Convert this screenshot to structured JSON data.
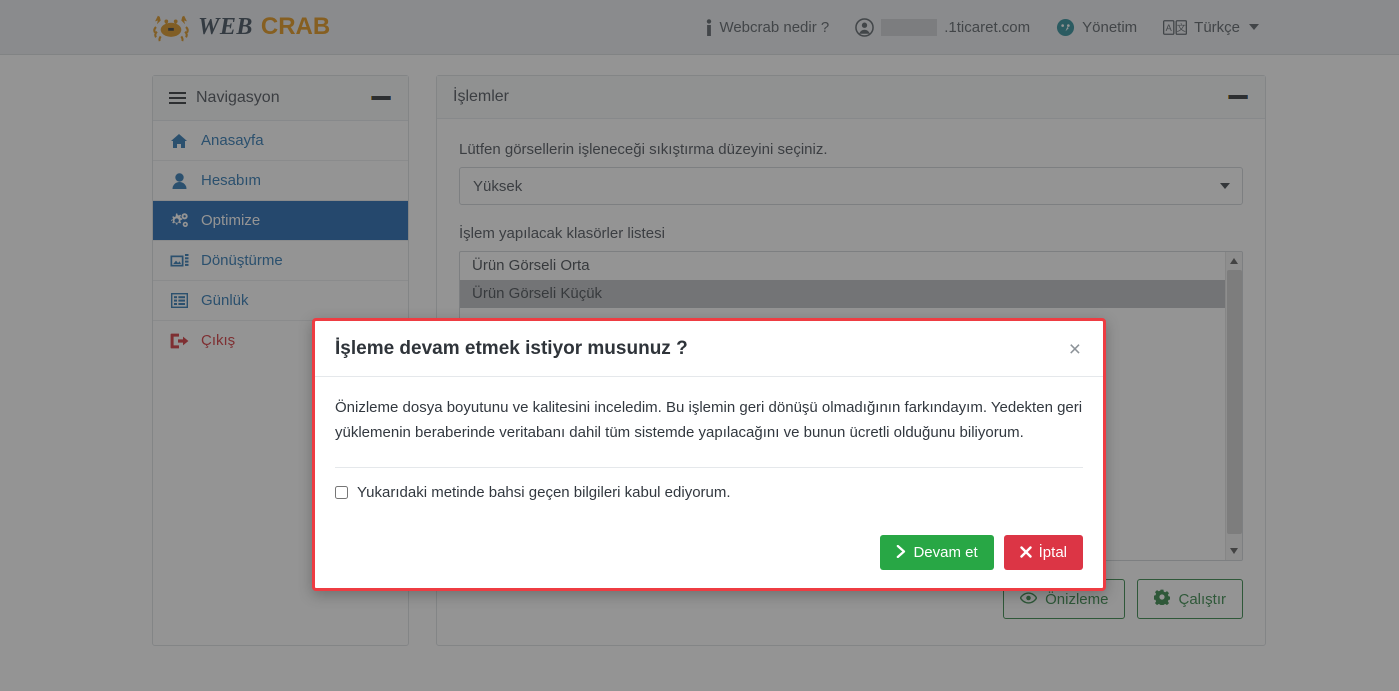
{
  "navbar": {
    "brand": {
      "word_left": "WEB",
      "word_right": "CRAB",
      "icon": "crab-icon"
    },
    "links": [
      {
        "label": "Webcrab nedir ?",
        "icon": "info-icon"
      },
      {
        "label": ".1ticaret.com",
        "icon": "user-circle-icon",
        "redacted": true
      },
      {
        "label": "Yönetim",
        "icon": "dashboard-icon"
      },
      {
        "label": "Türkçe",
        "icon": "language-icon",
        "caret": true
      }
    ]
  },
  "sidebar": {
    "title": "Navigasyon",
    "title_icon": "hamburger-icon",
    "collapse_icon": "minus-icon",
    "items": [
      {
        "label": "Anasayfa",
        "icon": "home-icon",
        "active": false
      },
      {
        "label": "Hesabım",
        "icon": "user-icon",
        "active": false
      },
      {
        "label": "Optimize",
        "icon": "gears-icon",
        "active": true
      },
      {
        "label": "Dönüştürme",
        "icon": "images-icon",
        "active": false
      },
      {
        "label": "Günlük",
        "icon": "list-icon",
        "active": false
      },
      {
        "label": "Çıkış",
        "icon": "logout-icon",
        "active": false
      }
    ]
  },
  "main": {
    "title": "İşlemler",
    "collapse_icon": "minus-icon",
    "compression": {
      "label": "Lütfen görsellerin işleneceği sıkıştırma düzeyini seçiniz.",
      "selected": "Yüksek",
      "options": [
        "Yüksek"
      ]
    },
    "folders": {
      "label": "İşlem yapılacak klasörler listesi",
      "options": [
        {
          "label": "Ürün Görseli Orta",
          "selected": false
        },
        {
          "label": "Ürün Görseli Küçük",
          "selected": true
        }
      ]
    },
    "buttons": [
      {
        "label": "Önizleme",
        "icon": "eye-icon"
      },
      {
        "label": "Çalıştır",
        "icon": "gear-icon"
      }
    ]
  },
  "modal": {
    "title": "İşleme devam etmek istiyor musunuz ?",
    "close_label": "×",
    "paragraph": "Önizleme dosya boyutunu ve kalitesini inceledim. Bu işlemin geri dönüşü olmadığının farkındayım. Yedekten geri yüklemenin beraberinde veritabanı dahil tüm sistemde yapılacağını ve bunun ücretli olduğunu biliyorum.",
    "agree_label": "Yukarıdaki metinde bahsi geçen bilgileri kabul ediyorum.",
    "agree_checked": false,
    "confirm_label": "Devam et",
    "confirm_icon": "chevron-right-icon",
    "cancel_label": "İptal",
    "cancel_icon": "x-icon"
  },
  "colors": {
    "brand_orange": "#e08a00",
    "sidebar_active": "#0a58a8",
    "link_blue": "#1769aa",
    "danger_red": "#cf2027",
    "modal_border": "#ee3c42",
    "confirm_green": "#28a745",
    "cancel_red": "#dc3545",
    "outline_green": "#1f7a35",
    "teal": "#17a2b8"
  }
}
